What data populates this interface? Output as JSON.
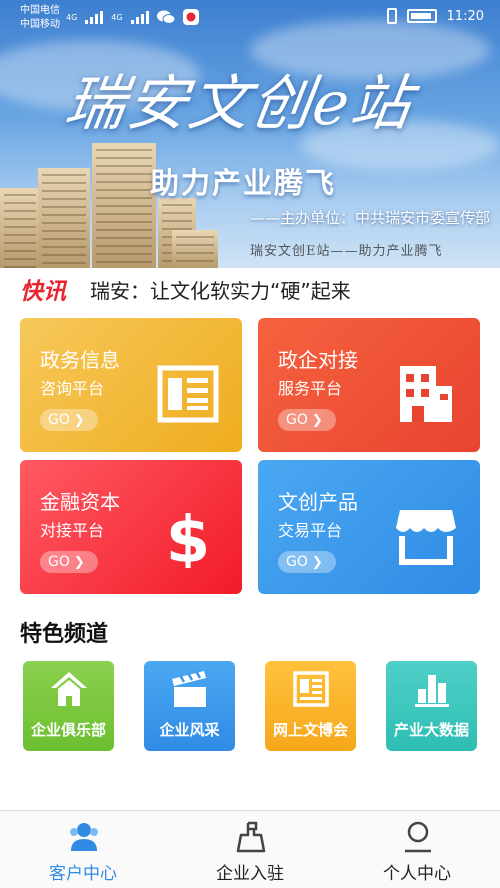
{
  "status_bar": {
    "carrier_1": "中国电信",
    "carrier_2": "中国移动",
    "net_1": "4G",
    "net_2": "4G",
    "time": "11:20"
  },
  "banner": {
    "title": "瑞安文创e站",
    "slogan": "助力产业腾飞",
    "host": "——主办单位：中共瑞安市委宣传部",
    "watermark": "瑞安文创E站——助力产业腾飞"
  },
  "news": {
    "tag": "快讯",
    "headline": "瑞安：让文化软实力“硬”起来"
  },
  "cards": [
    {
      "title": "政务信息",
      "subtitle": "咨询平台",
      "go": "GO",
      "icon": "newspaper-icon"
    },
    {
      "title": "政企对接",
      "subtitle": "服务平台",
      "go": "GO",
      "icon": "building-icon"
    },
    {
      "title": "金融资本",
      "subtitle": "对接平台",
      "go": "GO",
      "icon": "dollar-icon"
    },
    {
      "title": "文创产品",
      "subtitle": "交易平台",
      "go": "GO",
      "icon": "storefront-icon"
    }
  ],
  "featured": {
    "title": "特色频道",
    "items": [
      {
        "label": "企业俱乐部",
        "icon": "home-icon",
        "color": "#78c43a"
      },
      {
        "label": "企业风采",
        "icon": "clapperboard-icon",
        "color": "#3a9bec"
      },
      {
        "label": "网上文博会",
        "icon": "newspaper-icon",
        "color": "#f9b42a"
      },
      {
        "label": "产业大数据",
        "icon": "bar-chart-icon",
        "color": "#3cc6bd"
      }
    ]
  },
  "bottom_nav": {
    "items": [
      {
        "label": "客户中心",
        "icon": "users-icon",
        "active": true
      },
      {
        "label": "企业入驻",
        "icon": "checkin-icon",
        "active": false
      },
      {
        "label": "个人中心",
        "icon": "person-icon",
        "active": false
      }
    ]
  },
  "colors": {
    "accent": "#2f8be4",
    "news_tag": "#e8262f"
  }
}
